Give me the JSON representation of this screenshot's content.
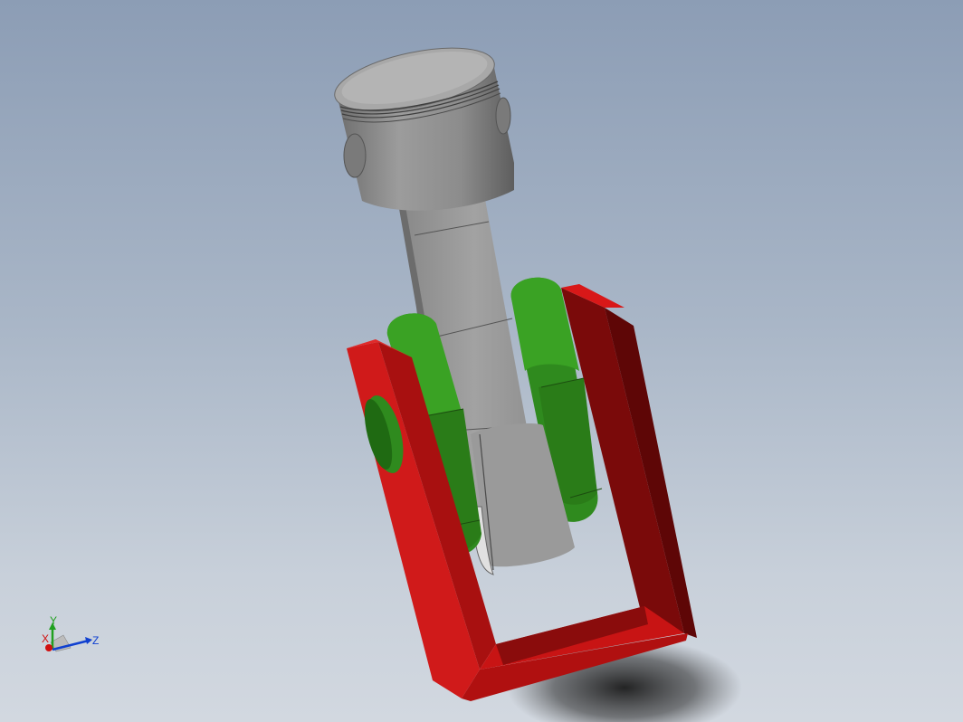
{
  "viewport": {
    "background_top": "#8c9db5",
    "background_bottom": "#d2d8e0"
  },
  "model": {
    "parts": [
      "piston",
      "connecting-rod",
      "crank-webs",
      "frame"
    ],
    "colors": {
      "piston": "#8a8a8a",
      "rod": "#9a9a9a",
      "crank": "#2f8f1f",
      "frame": "#c81414"
    }
  },
  "triad": {
    "x_label": "X",
    "y_label": "Y",
    "z_label": "Z",
    "x_color": "#d01010",
    "y_color": "#20a020",
    "z_color": "#1040d0"
  }
}
